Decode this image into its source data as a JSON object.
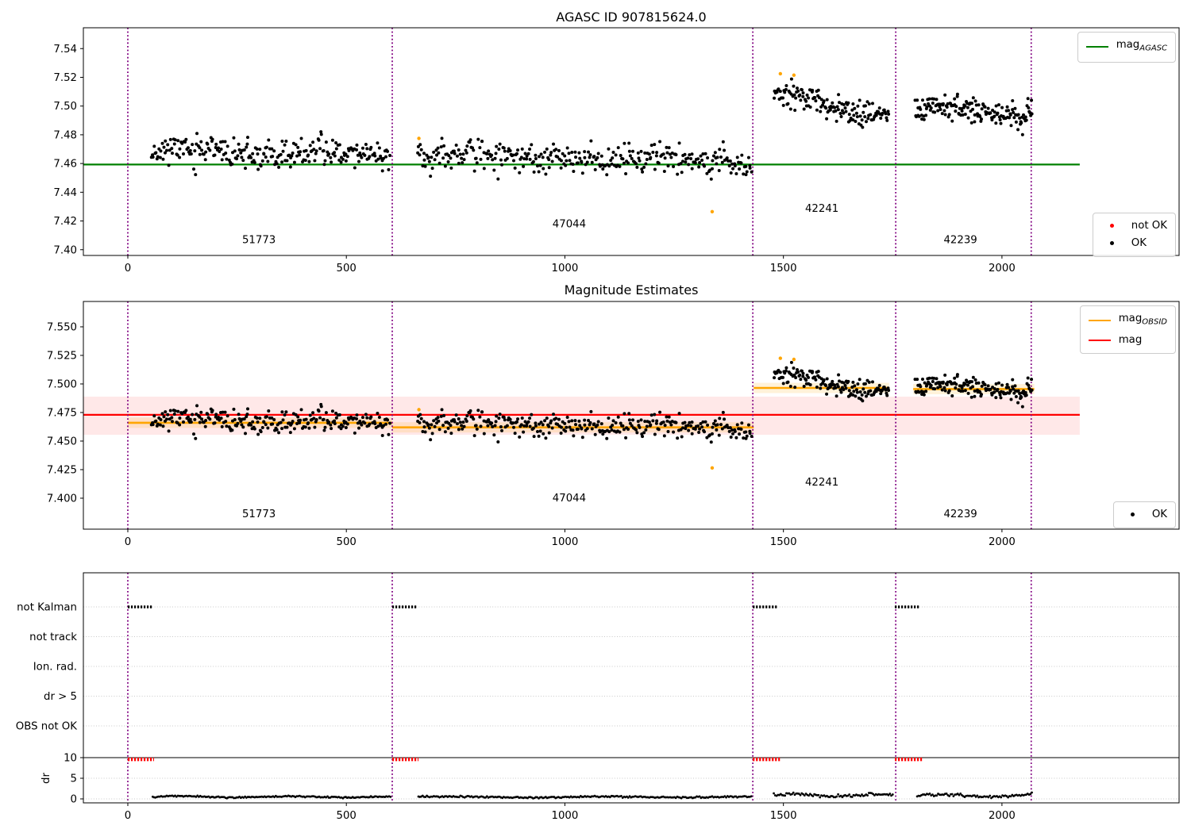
{
  "figure": {
    "background": "#ffffff"
  },
  "titles": {
    "top": "AGASC ID 907815624.0",
    "middle": "Magnitude Estimates"
  },
  "legends": {
    "agasc": {
      "main": "mag",
      "sub": "AGASC",
      "color": "#008000"
    },
    "status": {
      "not_ok": "not OK",
      "ok": "OK",
      "not_ok_color": "#ff0000",
      "ok_color": "#000000"
    },
    "obsid": {
      "main": "mag",
      "sub": "OBSID",
      "color": "#ffa500",
      "mag_label": "mag",
      "mag_color": "#ff0000"
    },
    "ok_only": {
      "ok": "OK",
      "ok_color": "#000000"
    }
  },
  "chart_data": [
    {
      "type": "scatter",
      "title": "AGASC ID 907815624.0",
      "xlim": [
        -101.7,
        2405.3
      ],
      "ylim": [
        7.396,
        7.5545
      ],
      "xticks": [
        0,
        500,
        1000,
        1500,
        2000
      ],
      "xtick_labels": [
        "0",
        "500",
        "1000",
        "1500",
        "2000"
      ],
      "yticks": [
        7.54,
        7.52,
        7.5,
        7.48,
        7.46,
        7.44,
        7.42,
        7.4
      ],
      "ytick_labels": [
        "7.54",
        "7.52",
        "7.50",
        "7.48",
        "7.46",
        "7.44",
        "7.42",
        "7.40"
      ],
      "hline": {
        "label": "mag_AGASC",
        "value": 7.4593,
        "color": "#008000",
        "x_range": [
          -101.7,
          2178
        ]
      },
      "vlines": {
        "color": "#800080",
        "x": [
          0,
          605,
          1430,
          1757,
          2067
        ]
      },
      "obsid_labels": [
        {
          "text": "51773",
          "x": 300,
          "y": 7.4045
        },
        {
          "text": "47044",
          "x": 1010,
          "y": 7.4155
        },
        {
          "text": "42241",
          "x": 1588,
          "y": 7.4265
        },
        {
          "text": "42239",
          "x": 1905,
          "y": 7.4045
        }
      ],
      "series": {
        "ok": {
          "name": "OK",
          "color": "#000000",
          "clusters": [
            {
              "obsid": "51773",
              "n": 250,
              "x_range": [
                53,
                600
              ],
              "mean_start": 7.4685,
              "mean_end": 7.4655,
              "wave_amp": 0.0025,
              "wave_period": 55,
              "sigma": 0.0048,
              "seed": 11
            },
            {
              "obsid": "47044",
              "n": 330,
              "x_range": [
                662,
                1428
              ],
              "mean_start": 7.466,
              "mean_end": 7.4615,
              "wave_amp": 0.0022,
              "wave_period": 70,
              "sigma": 0.005,
              "seed": 22
            },
            {
              "obsid": "42241",
              "n": 150,
              "x_range": [
                1478,
                1742
              ],
              "mean_start": 7.508,
              "mean_end": 7.4925,
              "wave_amp": 0.0025,
              "wave_period": 38,
              "sigma": 0.0045,
              "seed": 33
            },
            {
              "obsid": "42239",
              "n": 165,
              "x_range": [
                1800,
                2070
              ],
              "mean_start": 7.497,
              "mean_end": 7.4955,
              "wave_amp": 0.003,
              "wave_period": 45,
              "sigma": 0.0042,
              "seed": 44
            }
          ]
        },
        "not_ok": {
          "name": "not OK",
          "color": "#ffa500",
          "points": [
            [
              666,
              7.4775
            ],
            [
              1337,
              7.4265
            ],
            [
              1493,
              7.5225
            ],
            [
              1524,
              7.5215
            ]
          ]
        }
      }
    },
    {
      "type": "scatter",
      "title": "Magnitude Estimates",
      "xlim": [
        -101.7,
        2405.3
      ],
      "ylim": [
        7.3729,
        7.5722
      ],
      "xticks": [
        0,
        500,
        1000,
        1500,
        2000
      ],
      "xtick_labels": [
        "0",
        "500",
        "1000",
        "1500",
        "2000"
      ],
      "yticks": [
        7.55,
        7.525,
        7.5,
        7.475,
        7.45,
        7.425,
        7.4
      ],
      "ytick_labels": [
        "7.550",
        "7.525",
        "7.500",
        "7.475",
        "7.450",
        "7.425",
        "7.400"
      ],
      "hline": {
        "label": "mag",
        "value": 7.473,
        "color": "#ff0000",
        "x_range": [
          -101.7,
          2178
        ],
        "band": [
          7.4555,
          7.4889
        ],
        "band_color": "rgba(255,0,0,0.09)"
      },
      "obsid_segments": {
        "label": "mag_OBSID",
        "color": "#ffa500",
        "band_half_width": 0.0045,
        "band_color": "rgba(255,165,0,0.15)",
        "segments": [
          {
            "obsid": "51773",
            "x": [
              0,
              605
            ],
            "value": 7.466
          },
          {
            "obsid": "47044",
            "x": [
              605,
              1432
            ],
            "value": 7.462
          },
          {
            "obsid": "42241",
            "x": [
              1432,
              1742
            ],
            "value": 7.4965
          },
          {
            "obsid": "42239",
            "x": [
              1797,
              2074
            ],
            "value": 7.4955
          }
        ]
      },
      "vlines": {
        "color": "#800080",
        "x": [
          0,
          605,
          1430,
          1757,
          2067
        ]
      },
      "obsid_labels": [
        {
          "text": "51773",
          "x": 300,
          "y": 7.3833
        },
        {
          "text": "47044",
          "x": 1010,
          "y": 7.3972
        },
        {
          "text": "42241",
          "x": 1588,
          "y": 7.4111
        },
        {
          "text": "42239",
          "x": 1905,
          "y": 7.3833
        }
      ],
      "series_ref": 0
    },
    {
      "type": "flags",
      "rows": [
        "not Kalman",
        "not track",
        "Ion. rad.",
        "dr > 5",
        "OBS not OK"
      ],
      "dr_ticks": [
        10,
        5,
        0
      ],
      "dr_tick_labels": [
        "10",
        "5",
        "0"
      ],
      "dr_axis_label": "dr",
      "xticks": [
        0,
        500,
        1000,
        1500,
        2000
      ],
      "xtick_labels": [
        "0",
        "500",
        "1000",
        "1500",
        "2000"
      ],
      "vlines": {
        "color": "#800080",
        "x": [
          0,
          605,
          1430,
          1757,
          2067
        ]
      },
      "grid_color": "#c9c9c9",
      "dr_cap_line": {
        "value": 10,
        "color": "#000000"
      },
      "flag_segments": {
        "row": "not Kalman",
        "color": "#000000",
        "x": [
          [
            0,
            57
          ],
          [
            605,
            662
          ],
          [
            1430,
            1488
          ],
          [
            1755,
            1813
          ]
        ]
      },
      "dr_big_segments": {
        "value": 9.6,
        "color": "#ff0000",
        "x": [
          [
            0,
            60
          ],
          [
            605,
            665
          ],
          [
            1430,
            1492
          ],
          [
            1755,
            1817
          ]
        ]
      },
      "dr_trace": {
        "color": "#000000",
        "step": 3.2,
        "segments": [
          {
            "x": [
              57,
              602
            ],
            "mean": 0.5,
            "sigma": 0.1,
            "wave_amp": 0.15,
            "wave_period": 40,
            "seed": 5
          },
          {
            "x": [
              665,
              1428
            ],
            "mean": 0.45,
            "sigma": 0.1,
            "wave_amp": 0.12,
            "wave_period": 55,
            "seed": 6
          },
          {
            "x": [
              1478,
              1753
            ],
            "mean": 0.85,
            "sigma": 0.18,
            "wave_amp": 0.3,
            "wave_period": 30,
            "seed": 7
          },
          {
            "x": [
              1806,
              2070
            ],
            "mean": 0.8,
            "sigma": 0.15,
            "wave_amp": 0.25,
            "wave_period": 35,
            "seed": 8
          }
        ]
      }
    }
  ]
}
